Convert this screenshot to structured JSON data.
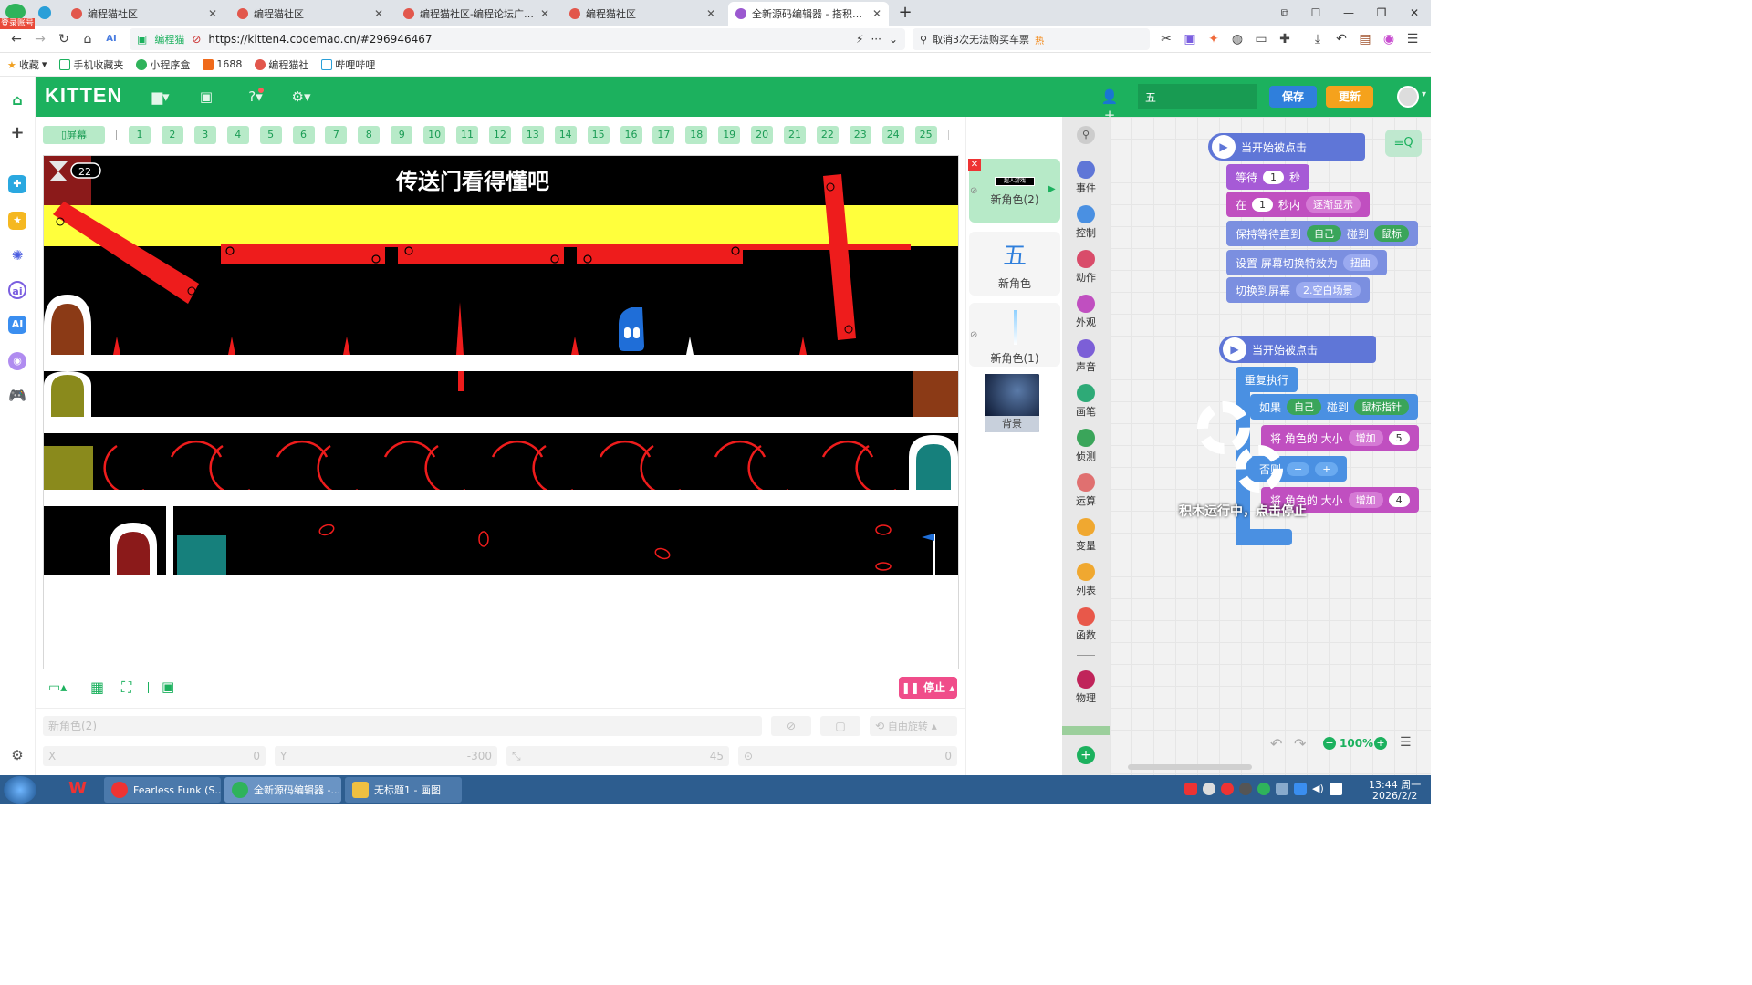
{
  "browser": {
    "tabs": [
      {
        "title": "编程猫社区",
        "active": false
      },
      {
        "title": "编程猫社区",
        "active": false
      },
      {
        "title": "编程猫社区-编程论坛广场-编程",
        "active": false
      },
      {
        "title": "编程猫社区",
        "active": false
      },
      {
        "title": "全新源码编辑器 - 搭积木一样",
        "active": true
      }
    ],
    "badge": "登录账号",
    "site_chip": "编程猫",
    "url": "https://kitten4.codemao.cn/#296946467",
    "search_text": "取消3次无法购买车票",
    "search_tag": "热",
    "bookmarks": [
      "收藏",
      "手机收藏夹",
      "小程序盒",
      "1688",
      "编程猫社",
      "哔哩哔哩"
    ]
  },
  "app": {
    "logo": "KITTEN",
    "project_name": "五",
    "save_label": "保存",
    "update_label": "更新",
    "accent": "#1cb15e"
  },
  "scenes": {
    "screen_label": "屏幕",
    "numbers": [
      "1",
      "2",
      "3",
      "4",
      "5",
      "6",
      "7",
      "8",
      "9",
      "10",
      "11",
      "12",
      "13",
      "14",
      "15",
      "16",
      "17",
      "18",
      "19",
      "20",
      "21",
      "22",
      "23",
      "24",
      "25"
    ],
    "add_label": "+"
  },
  "stage": {
    "title_text": "传送门看得懂吧",
    "timer_value": "22",
    "stop_label": "停止"
  },
  "props": {
    "sprite_name": "新角色(2)",
    "rotate_label": "自由旋转",
    "x_label": "X",
    "x_value": "0",
    "y_label": "Y",
    "y_value": "-300",
    "size_value": "45",
    "dir_value": "0"
  },
  "sprites": {
    "list": [
      {
        "name": "新角色(2)",
        "thumb_text": "超人游戏"
      },
      {
        "name": "新角色",
        "thumb_text": "五"
      },
      {
        "name": "新角色(1)",
        "thumb_text": ""
      }
    ],
    "background_label": "背景"
  },
  "categories": [
    {
      "label": "事件",
      "color": "#5f76d7"
    },
    {
      "label": "控制",
      "color": "#4a90e2"
    },
    {
      "label": "动作",
      "color": "#d94c6a"
    },
    {
      "label": "外观",
      "color": "#c04fc0"
    },
    {
      "label": "声音",
      "color": "#7c5fd7"
    },
    {
      "label": "画笔",
      "color": "#2eaa77"
    },
    {
      "label": "侦测",
      "color": "#3aa55a"
    },
    {
      "label": "运算",
      "color": "#e07070"
    },
    {
      "label": "变量",
      "color": "#f0a830"
    },
    {
      "label": "列表",
      "color": "#f0a830"
    },
    {
      "label": "函数",
      "color": "#e8584a"
    },
    {
      "label": "物理",
      "color": "#c0245a"
    }
  ],
  "blocks": {
    "group1": {
      "hat": "当开始被点击",
      "wait_label": "等待",
      "wait_value": "1",
      "wait_unit": "秒",
      "in_label": "在",
      "in_value": "1",
      "in_unit": "秒内",
      "in_effect": "逐渐显示",
      "keep_label": "保持等待直到",
      "keep_self": "自己",
      "keep_touch": "碰到",
      "keep_target": "鼠标",
      "set_label": "设置 屏幕切换特效为",
      "set_value": "扭曲",
      "switch_label": "切换到屏幕",
      "switch_value": "2.空白场景"
    },
    "group2": {
      "hat": "当开始被点击",
      "repeat_label": "重复执行",
      "if_label": "如果",
      "if_self": "自己",
      "if_touch": "碰到",
      "if_target": "鼠标指针",
      "size1_label": "将 角色的 大小",
      "size1_op": "增加",
      "size1_value": "5",
      "else_label": "否则",
      "size2_label": "将 角色的 大小",
      "size2_op": "增加",
      "size2_value": "4"
    },
    "running_text": "积木运行中，点击停止",
    "zoom": "100%"
  },
  "taskbar": {
    "items": [
      "Fearless Funk (S...",
      "全新源码编辑器 -...",
      "无标题1 - 画图"
    ],
    "time": "13:44 周一",
    "date": "2026/2/2"
  }
}
